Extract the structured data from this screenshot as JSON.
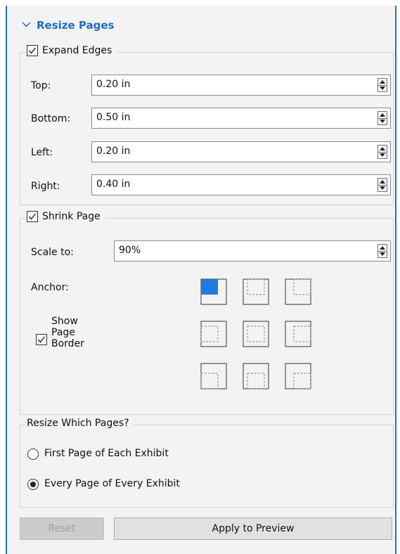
{
  "header": {
    "title": "Resize Pages",
    "chevron_icon": "chevron-down-icon"
  },
  "expand_edges": {
    "label": "Expand Edges",
    "checked": true,
    "fields": [
      {
        "label": "Top:",
        "value": "0.20 in"
      },
      {
        "label": "Bottom:",
        "value": "0.50 in"
      },
      {
        "label": "Left:",
        "value": "0.20 in"
      },
      {
        "label": "Right:",
        "value": "0.40 in"
      }
    ]
  },
  "shrink_page": {
    "label": "Shrink Page",
    "checked": true,
    "scale_label": "Scale to:",
    "scale_value": "90%",
    "anchor_label": "Anchor:",
    "anchor_selected": "top-left",
    "show_border": {
      "line1": "Show",
      "line2": "Page",
      "line3": "Border",
      "checked": true
    }
  },
  "resize_which": {
    "label": "Resize Which Pages?",
    "options": [
      {
        "label": "First Page of Each Exhibit",
        "selected": false
      },
      {
        "label": "Every Page of Every Exhibit",
        "selected": true
      }
    ]
  },
  "buttons": {
    "reset": "Reset",
    "apply": "Apply to Preview"
  },
  "colors": {
    "accent": "#1a6fc8",
    "anchor_fill": "#1e7be0"
  }
}
